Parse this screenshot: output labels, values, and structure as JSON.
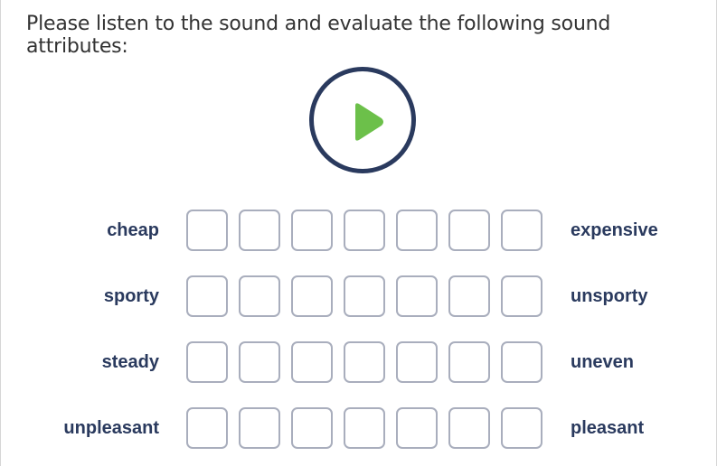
{
  "prompt": "Please listen to the sound and evaluate the following sound attributes:",
  "play_button": {
    "icon": "play-icon",
    "ring_color": "#2a3a5e",
    "icon_color": "#6cc04a"
  },
  "scale_points": 7,
  "rows": [
    {
      "left": "cheap",
      "right": "expensive"
    },
    {
      "left": "sporty",
      "right": "unsporty"
    },
    {
      "left": "steady",
      "right": "uneven"
    },
    {
      "left": "unpleasant",
      "right": "pleasant"
    }
  ]
}
